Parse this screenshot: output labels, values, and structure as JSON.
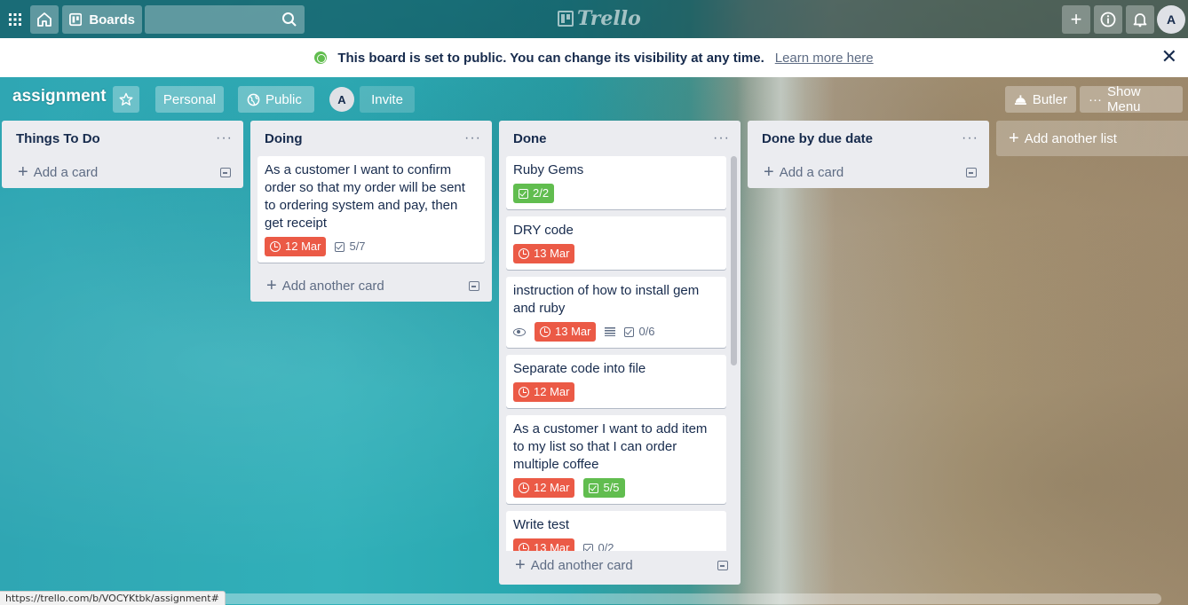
{
  "topbar": {
    "boards_label": "Boards",
    "logo_text": "Trello",
    "avatar_initial": "A"
  },
  "banner": {
    "message": "This board is set to public. You can change its visibility at any time.",
    "link": "Learn more here"
  },
  "board": {
    "title": "assignment",
    "personal_label": "Personal",
    "public_label": "Public",
    "member_initial": "A",
    "invite_label": "Invite",
    "butler_label": "Butler",
    "menu_label": "Show Menu"
  },
  "lists": [
    {
      "title": "Things To Do",
      "add_label": "Add a card",
      "cards": []
    },
    {
      "title": "Doing",
      "add_label": "Add another card",
      "cards": [
        {
          "title": "As a customer I want to confirm order so that my order will be sent to ordering system and pay, then get receipt",
          "due": "12 Mar",
          "checklist": "5/7"
        }
      ]
    },
    {
      "title": "Done",
      "add_label": "Add another card",
      "cards": [
        {
          "title": "Ruby Gems",
          "checklist": "2/2"
        },
        {
          "title": "DRY code",
          "due": "13 Mar"
        },
        {
          "title": "instruction of how to install gem and ruby",
          "due": "13 Mar",
          "checklist": "0/6"
        },
        {
          "title": "Separate code into file",
          "due": "12 Mar"
        },
        {
          "title": "As a customer I want to add item to my list so that I can order multiple coffee",
          "due": "12 Mar",
          "checklist": "5/5"
        },
        {
          "title": "Write test",
          "due": "13 Mar",
          "checklist": "0/2"
        }
      ]
    },
    {
      "title": "Done by due date",
      "add_label": "Add a card",
      "cards": []
    }
  ],
  "add_list_label": "Add another list",
  "status_url": "https://trello.com/b/VOCYKtbk/assignment#",
  "colors": {
    "due_red": "#eb5a46",
    "done_green": "#61bd4f",
    "list_bg": "#ebecf0"
  }
}
